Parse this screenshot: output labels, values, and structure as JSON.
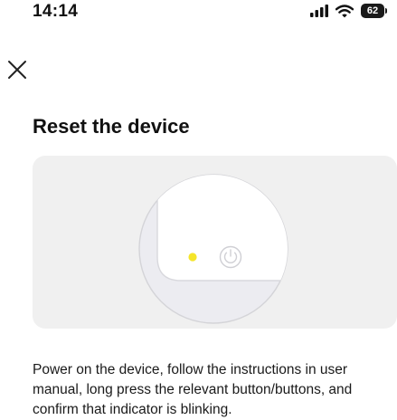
{
  "status_bar": {
    "time": "14:14",
    "icons": [
      "signal-icon",
      "wifi-icon",
      "battery-icon"
    ],
    "battery_level": "62"
  },
  "header": {
    "close_icon": "close-icon"
  },
  "main": {
    "title": "Reset the device",
    "illustration": {
      "icons": [
        "indicator-light",
        "power-icon"
      ],
      "indicator_color": "#f5e52a"
    },
    "instructions": "Power on the device, follow the instructions in user manual, long press the relevant button/buttons, and confirm that indicator is blinking."
  }
}
